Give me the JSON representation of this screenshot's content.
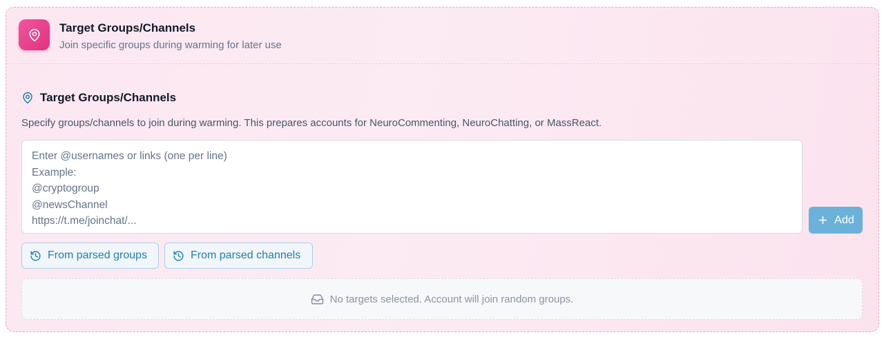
{
  "header": {
    "title": "Target Groups/Channels",
    "subtitle": "Join specific groups during warming for later use",
    "icon": "map-pin-icon"
  },
  "section": {
    "title": "Target Groups/Channels",
    "icon": "map-pin-icon",
    "description": "Specify groups/channels to join during warming. This prepares accounts for NeuroCommenting, NeuroChatting, or MassReact."
  },
  "targets_input": {
    "value": "",
    "placeholder": "Enter @usernames or links (one per line)\nExample:\n@cryptogroup\n@newsChannel\nhttps://t.me/joinchat/..."
  },
  "add_button": {
    "label": "Add",
    "icon": "plus-icon"
  },
  "source_buttons": [
    {
      "label": "From parsed groups",
      "icon": "history-icon"
    },
    {
      "label": "From parsed channels",
      "icon": "history-icon"
    }
  ],
  "empty_state": {
    "text": "No targets selected. Account will join random groups.",
    "icon": "inbox-icon"
  },
  "colors": {
    "accent_pink": "#e0337f",
    "accent_blue": "#1d7fae",
    "add_button_bg": "#6ab2da"
  }
}
